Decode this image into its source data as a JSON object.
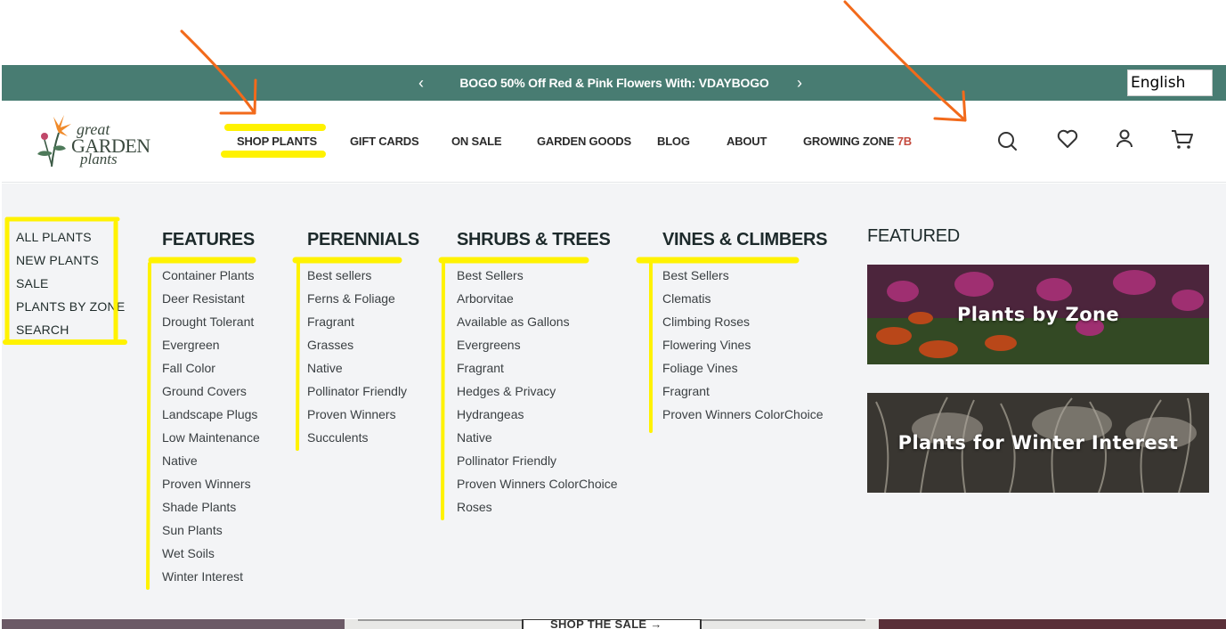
{
  "promo": {
    "prev_icon": "chevron-left-icon",
    "next_icon": "chevron-right-icon",
    "prev_glyph": "‹",
    "next_glyph": "›",
    "text": "BOGO 50% Off Red & Pink Flowers With: VDAYBOGO",
    "background": "#487c72"
  },
  "language": {
    "selected": "English"
  },
  "logo": {
    "great": "great",
    "garden": "GARDEN",
    "plants": "plants"
  },
  "nav": {
    "shop_plants": "SHOP PLANTS",
    "gift_cards": "GIFT CARDS",
    "on_sale": "ON SALE",
    "garden_goods": "GARDEN GOODS",
    "blog": "BLOG",
    "about": "ABOUT",
    "growing_zone_label": "GROWING ZONE",
    "growing_zone_value": "7B"
  },
  "header_icons": [
    "search-icon",
    "heart-icon",
    "account-icon",
    "cart-icon"
  ],
  "quick_links": [
    "ALL PLANTS",
    "NEW PLANTS",
    "SALE",
    "PLANTS BY ZONE",
    "SEARCH"
  ],
  "columns": [
    {
      "title": "FEATURES",
      "links": [
        "Container Plants",
        "Deer Resistant",
        "Drought Tolerant",
        "Evergreen",
        "Fall Color",
        "Ground Covers",
        "Landscape Plugs",
        "Low Maintenance",
        "Native",
        "Proven Winners",
        "Shade Plants",
        "Sun Plants",
        "Wet Soils",
        "Winter Interest"
      ]
    },
    {
      "title": "PERENNIALS",
      "links": [
        "Best sellers",
        "Ferns & Foliage",
        "Fragrant",
        "Grasses",
        "Native",
        "Pollinator Friendly",
        "Proven Winners",
        "Succulents"
      ]
    },
    {
      "title": "SHRUBS & TREES",
      "links": [
        "Best Sellers",
        "Arborvitae",
        "Available as Gallons",
        "Evergreens",
        "Fragrant",
        "Hedges & Privacy",
        "Hydrangeas",
        "Native",
        "Pollinator Friendly",
        "Proven Winners ColorChoice",
        "Roses"
      ]
    },
    {
      "title": "VINES & CLIMBERS",
      "links": [
        "Best Sellers",
        "Clematis",
        "Climbing Roses",
        "Flowering Vines",
        "Foliage Vines",
        "Fragrant",
        "Proven Winners ColorChoice"
      ]
    }
  ],
  "featured": {
    "title": "FEATURED",
    "cards": [
      "Plants by Zone",
      "Plants for Winter Interest"
    ]
  },
  "bottom": {
    "shop_sale": "SHOP THE SALE →"
  },
  "colors": {
    "accent_green": "#487c72",
    "zone_red": "#c44a3e",
    "highlight_yellow": "#fff200",
    "arrow_orange": "#f26a1b"
  }
}
